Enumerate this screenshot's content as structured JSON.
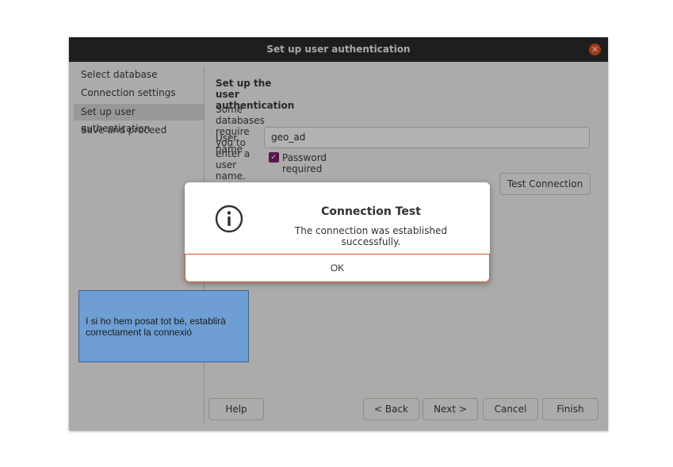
{
  "window": {
    "title": "Set up user authentication",
    "close_glyph": "✕"
  },
  "sidebar": {
    "items": [
      {
        "label": "Select database",
        "selected": false
      },
      {
        "label": "Connection settings",
        "selected": false
      },
      {
        "label": "Set up user authentication",
        "selected": true
      },
      {
        "label": "Save and proceed",
        "selected": false
      }
    ]
  },
  "main": {
    "heading": "Set up the user authentication",
    "description": "Some databases require you to enter a user name.",
    "username_label": "User name",
    "username_value": "geo_ad",
    "password_required_label": "Password required",
    "password_required_checked": true,
    "test_connection_label": "Test Connection"
  },
  "footer": {
    "help_label": "Help",
    "back_label": "< Back",
    "next_label": "Next >",
    "cancel_label": "Cancel",
    "finish_label": "Finish"
  },
  "dialog": {
    "title": "Connection Test",
    "message": "The connection was established successfully.",
    "ok_label": "OK",
    "icon": "info-icon"
  },
  "annotation": {
    "text": "I si ho hem posat tot bé, establirà correctament la connexió"
  },
  "colors": {
    "accent": "#e95420",
    "checkbox": "#77216f",
    "titlebar": "#2c2c2c",
    "note_fill": "#6e9ed3"
  }
}
